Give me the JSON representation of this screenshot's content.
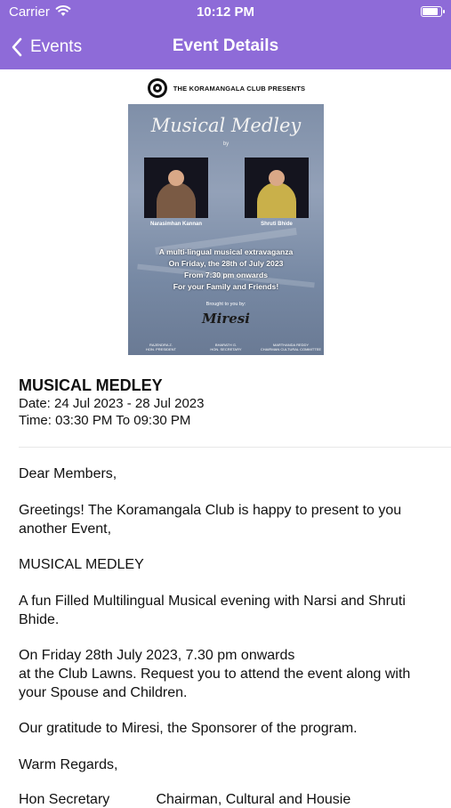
{
  "status_bar": {
    "carrier": "Carrier",
    "time": "10:12 PM",
    "battery_level_percent": 90
  },
  "nav": {
    "back_label": "Events",
    "title": "Event Details"
  },
  "poster": {
    "header": "THE KORAMANGALA CLUB PRESENTS",
    "title": "Musical Medley",
    "by": "by",
    "performer_1": "Narasimhan Kannan",
    "performer_2": "Shruti Bhide",
    "lines": [
      "A multi-lingual musical extravaganza",
      "On Friday, the 28th of July 2023",
      "From 7:30 pm onwards",
      "For your Family and Friends!"
    ],
    "brought_by": "Brought to you by:",
    "sponsor": "Miresi",
    "signatories": [
      "RAJENDRA Z.\nHON. PRESIDENT",
      "BHARATH G.\nHON. SECRETARY",
      "MARTHANDA REDDY\nCHAIRMAN CULTURAL COMMITTEE"
    ]
  },
  "event": {
    "title": "MUSICAL MEDLEY",
    "date": "Date: 24 Jul 2023 - 28 Jul 2023",
    "time": "Time: 03:30 PM  To  09:30 PM"
  },
  "body": {
    "greeting": "Dear Members,",
    "intro": "Greetings! The Koramangala Club is happy to present to you another Event,",
    "event_name": "MUSICAL MEDLEY",
    "description": "A fun Filled Multilingual Musical evening with  Narsi and Shruti Bhide.",
    "details_line1": "On Friday 28th July 2023, 7.30 pm onwards",
    "details_line2": "at the Club Lawns. Request you to attend the event along with your Spouse  and  Children.",
    "gratitude": "Our gratitude to Miresi, the  Sponsorer of the program.",
    "closing": "Warm Regards,",
    "sign_1": "Hon Secretary",
    "sign_2": "Chairman, Cultural and Housie"
  },
  "colors": {
    "header_bg": "#8e6bd8",
    "header_text": "#ffffff"
  }
}
